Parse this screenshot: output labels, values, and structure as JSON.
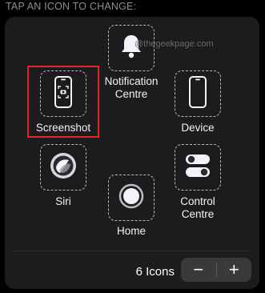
{
  "header": {
    "title": "TAP AN ICON TO CHANGE:"
  },
  "watermark": "@thegeekpage.com",
  "icons": {
    "notification": {
      "label": "Notification\nCentre",
      "icon": "bell-icon"
    },
    "screenshot": {
      "label": "Screenshot",
      "icon": "screenshot-icon",
      "selected": true
    },
    "device": {
      "label": "Device",
      "icon": "iphone-icon"
    },
    "siri": {
      "label": "Siri",
      "icon": "siri-icon"
    },
    "control": {
      "label": "Control\nCentre",
      "icon": "toggles-icon"
    },
    "home": {
      "label": "Home",
      "icon": "home-button-icon"
    }
  },
  "footer": {
    "count_label": "6 Icons",
    "minus": "−",
    "plus": "+"
  },
  "colors": {
    "background": "#000000",
    "panel": "#1c1c1e",
    "highlight": "#e0242b",
    "stepper": "#3a3a3c"
  }
}
